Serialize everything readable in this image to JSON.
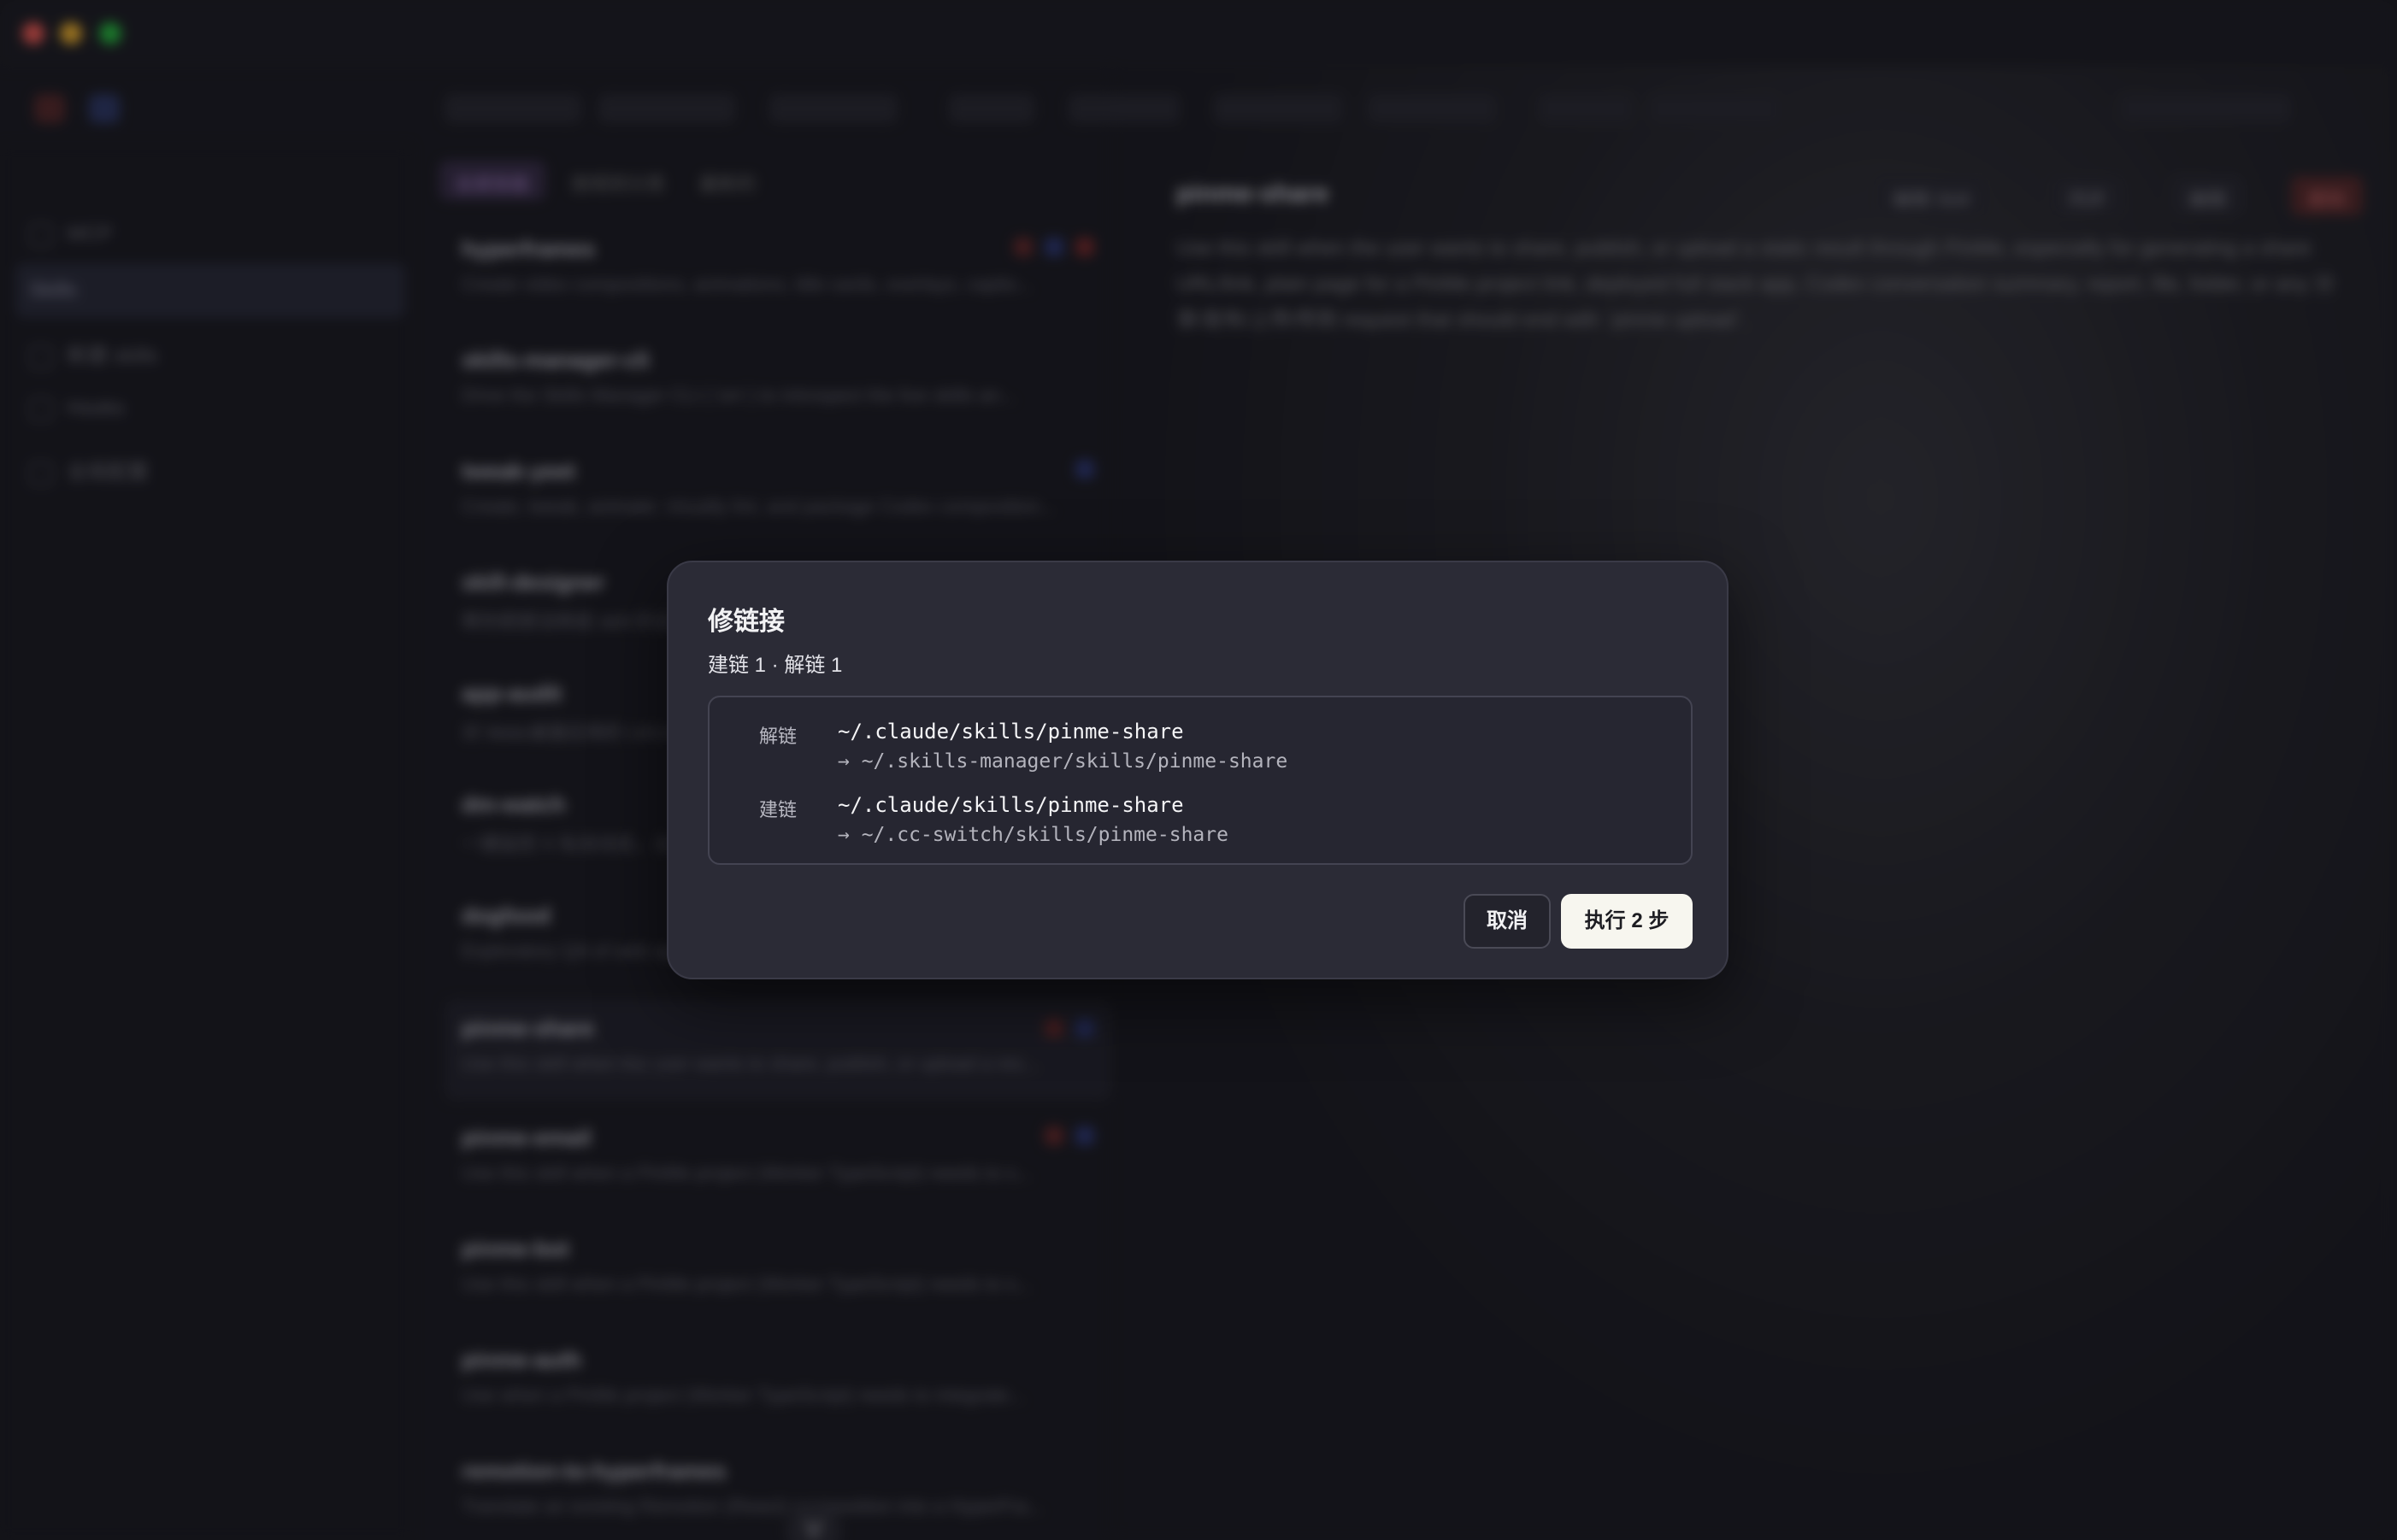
{
  "background": {
    "sidebar_items": [
      "MCP",
      "Skills",
      "新建 skills",
      "Hooks",
      "全局配置"
    ],
    "tabs": [
      "全部技能",
      "按规则分类",
      "最新的"
    ],
    "skills": [
      {
        "name": "hyperframes",
        "desc": "Create video compositions, animations, title cards, overlays, captio..."
      },
      {
        "name": "skills-manager-cli",
        "desc": "Drive the Skills Manager CLI (`sm`) to introspect the live skills an..."
      },
      {
        "name": "tweak-yeet",
        "desc": "Create, tweak, animate, visually lint, and package Codex composition..."
      },
      {
        "name": "skill-designer",
        "desc": "帮你把想法转成 skill 的设计文档，从 Agent Skill 思路开始..."
      },
      {
        "name": "app-audit",
        "desc": "对 Web/桌面应用的 UI/UX、性能、安全、架构..."
      },
      {
        "name": "dm-watch",
        "desc": "一键监控 X 私信动态，出现新消息后通知..."
      },
      {
        "name": "dogfood",
        "desc": "Exploratory QA of web apps: find bugs, UX issues..."
      },
      {
        "name": "pinme-share",
        "desc": "Use this skill when the user wants to share, publish, or upload a res..."
      },
      {
        "name": "pinme-email",
        "desc": "Use this skill when a PinMe project (Worker TypeScript) needs to s..."
      },
      {
        "name": "pinme-bot",
        "desc": "Use this skill when a PinMe project (Worker TypeScript) needs to s..."
      },
      {
        "name": "pinme-auth",
        "desc": "Use when a PinMe project (Worker TypeScript) needs to integrate..."
      },
      {
        "name": "remotion-to-hyperframes",
        "desc": "Translate an existing Remotion (React) composition into a HyperFra..."
      }
    ],
    "detail_title": "pinme-share",
    "detail_buttons": [
      "编辑 Skill",
      "同步",
      "编辑",
      "删除"
    ],
    "detail_desc": "Use this skill when the user wants to share, publish, or upload a static result through PinMe, especially for generating a share URL/link, plain page for a PinMe project link, deployed full stack app, Codex conversation summary, report, file, folder, or any 分享/发布/上传/传到 request that should end with `pinme upload`.",
    "handle_glyph": "V"
  },
  "modal": {
    "title": "修链接",
    "subtitle": "建链 1 · 解链 1",
    "operations": [
      {
        "kind": "解链",
        "path": "~/.claude/skills/pinme-share",
        "target": "→ ~/.skills-manager/skills/pinme-share"
      },
      {
        "kind": "建链",
        "path": "~/.claude/skills/pinme-share",
        "target": "→ ~/.cc-switch/skills/pinme-share"
      }
    ],
    "cancel_label": "取消",
    "execute_label": "执行 2 步"
  },
  "colors": {
    "modal_bg": "#2b2b36",
    "primary_button": "#f7f6ef",
    "close_light": "#ff5f57",
    "minimize_light": "#febc2e",
    "zoom_light": "#28c840"
  }
}
